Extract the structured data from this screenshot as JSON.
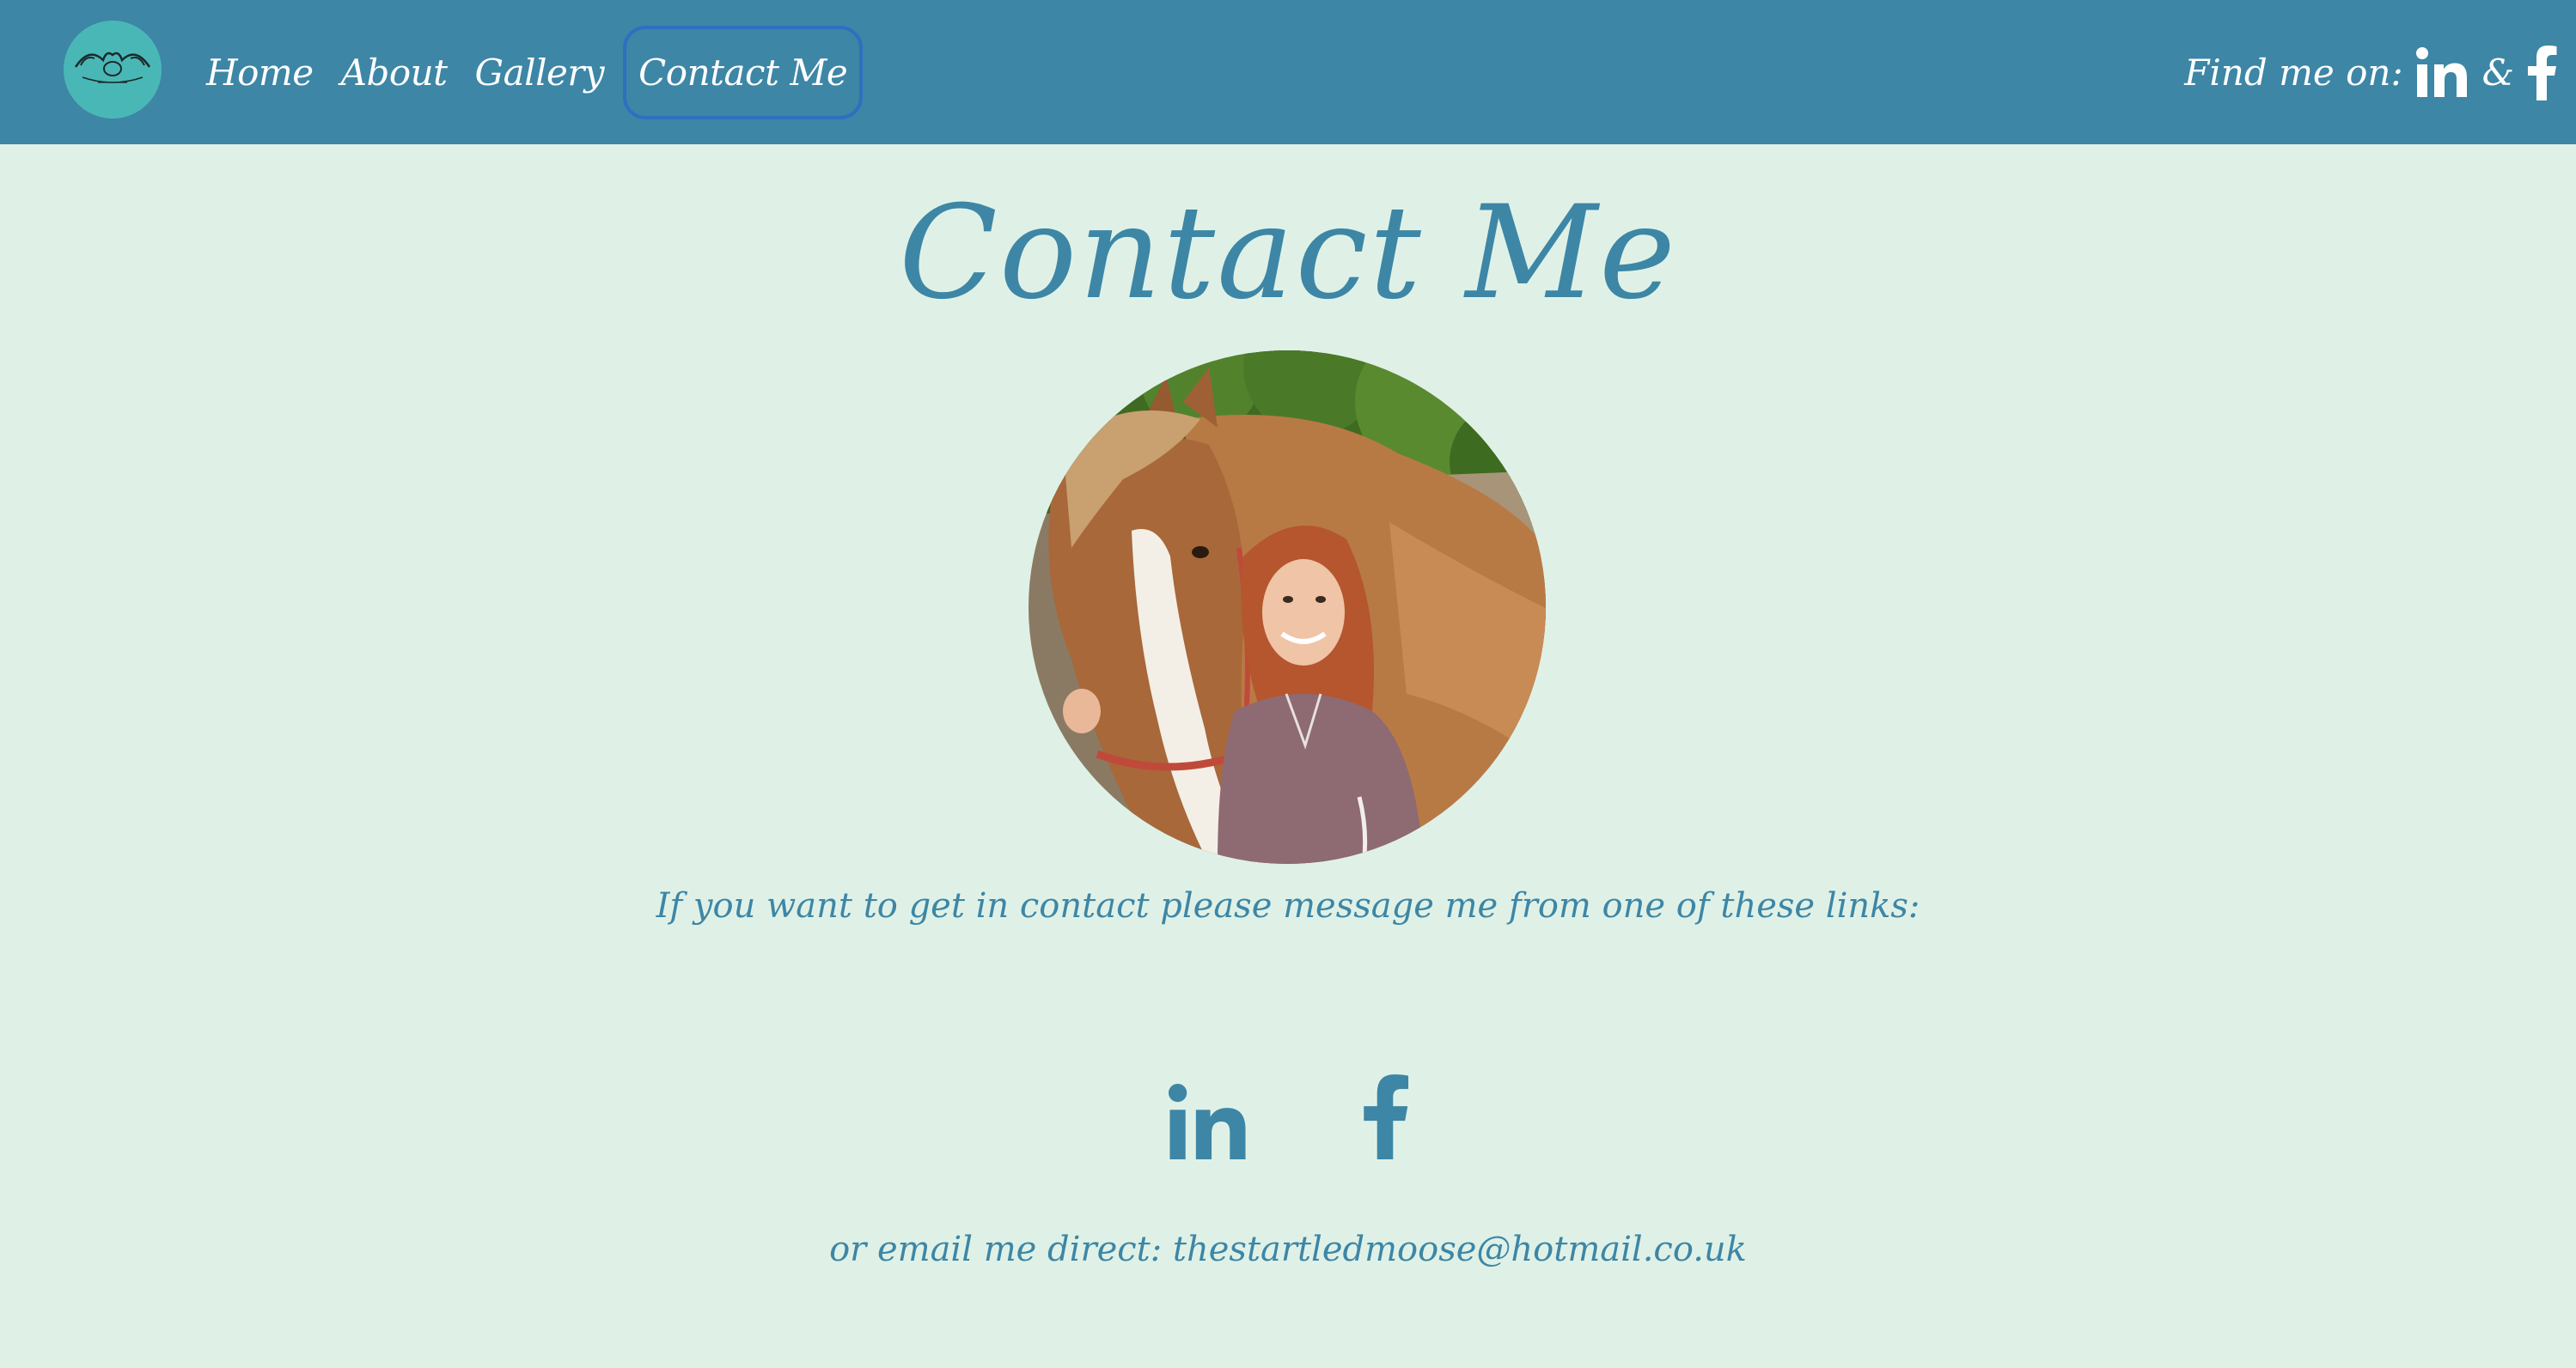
{
  "nav": {
    "links": [
      {
        "label": "Home"
      },
      {
        "label": "About"
      },
      {
        "label": "Gallery"
      },
      {
        "label": "Contact Me",
        "active": true
      }
    ],
    "find_me_label": "Find me on:",
    "ampersand": "&",
    "social_icons": [
      "linkedin-icon",
      "facebook-icon"
    ]
  },
  "main": {
    "title": "Contact Me",
    "contact_text": "If you want to get in contact please message me from one of these links:",
    "email_label": "or email me direct: thestartledmoose@hotmail.co.uk",
    "social_icons": [
      "linkedin-icon",
      "facebook-icon"
    ]
  },
  "colors": {
    "navbar": "#3d86a6",
    "background": "#dff1e6",
    "accent_text": "#3d86a6",
    "logo_bg": "#4ab7b7",
    "active_border": "#2f6fc0"
  }
}
